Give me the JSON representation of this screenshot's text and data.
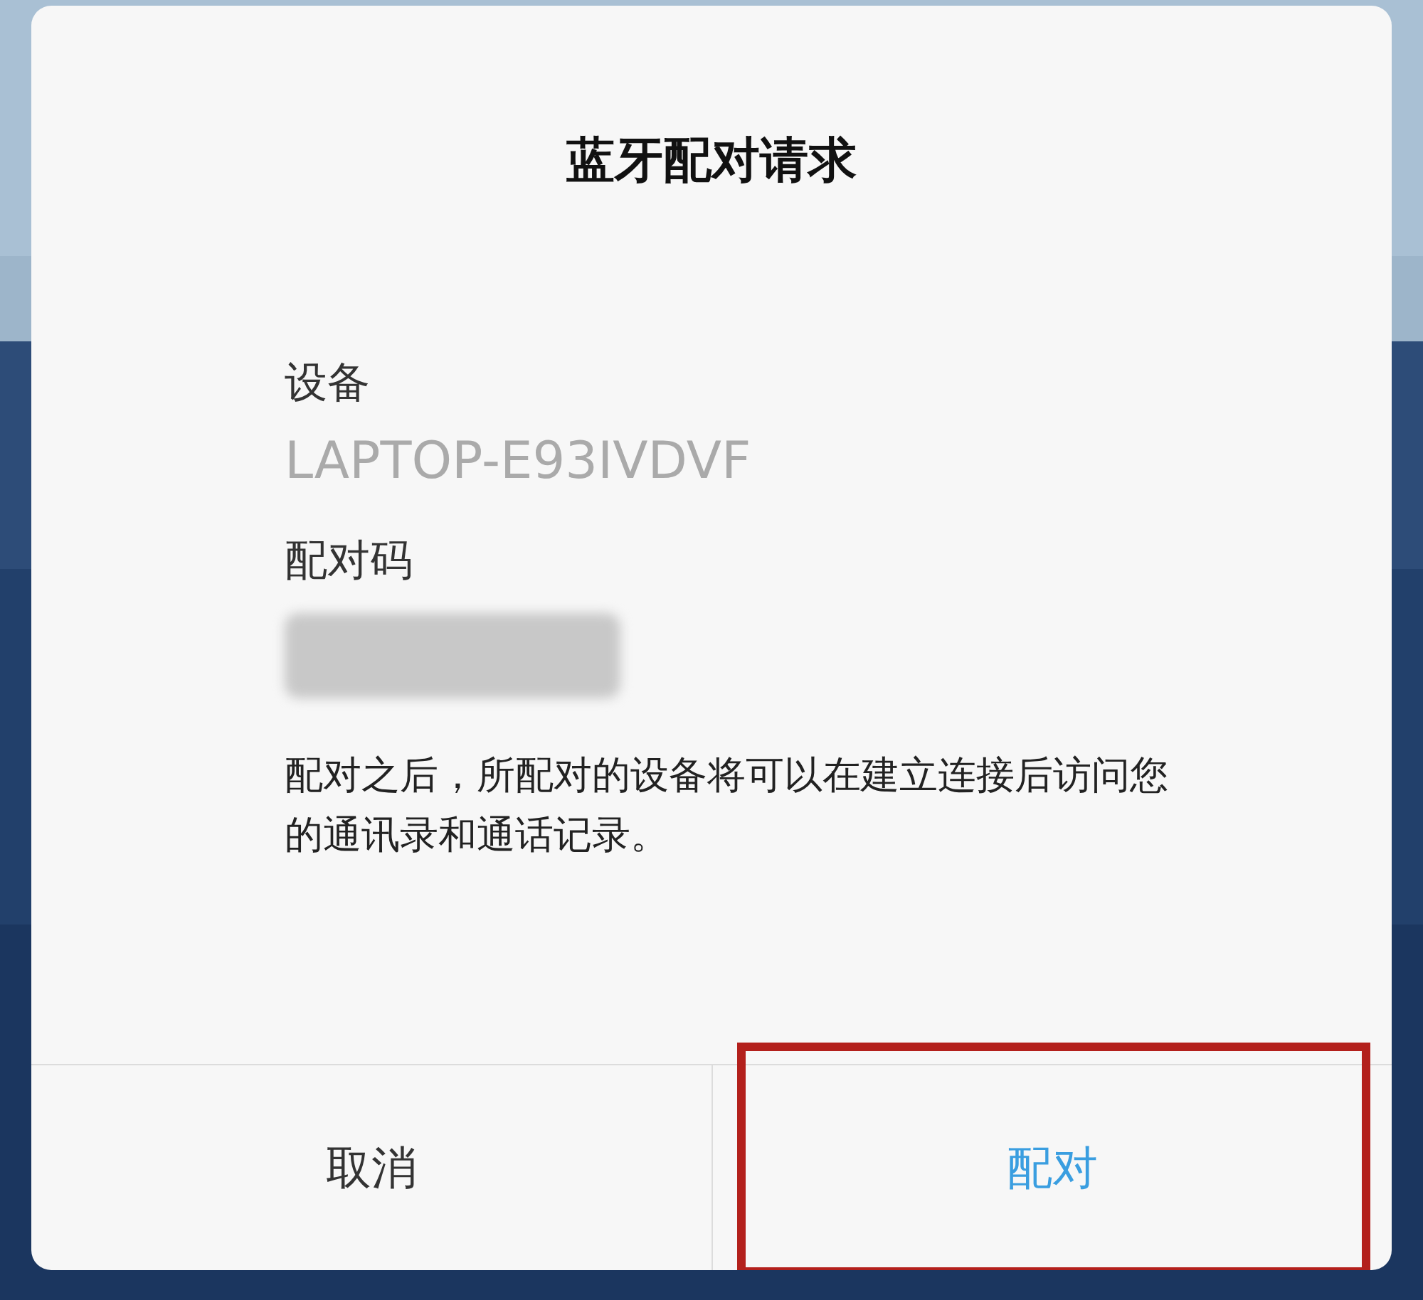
{
  "dialog": {
    "title": "蓝牙配对请求",
    "fields": [
      {
        "label": "设备",
        "value": "LAPTOP-E93IVDVF",
        "redacted": false
      },
      {
        "label": "配对码",
        "redacted": true
      }
    ],
    "message": "配对之后，所配对的设备将可以在建立连接后访问您的通讯录和通话记录。",
    "buttons": [
      {
        "label": "取消",
        "kind": "cancel",
        "highlighted": false
      },
      {
        "label": "配对",
        "kind": "confirm",
        "highlighted": true
      }
    ]
  }
}
